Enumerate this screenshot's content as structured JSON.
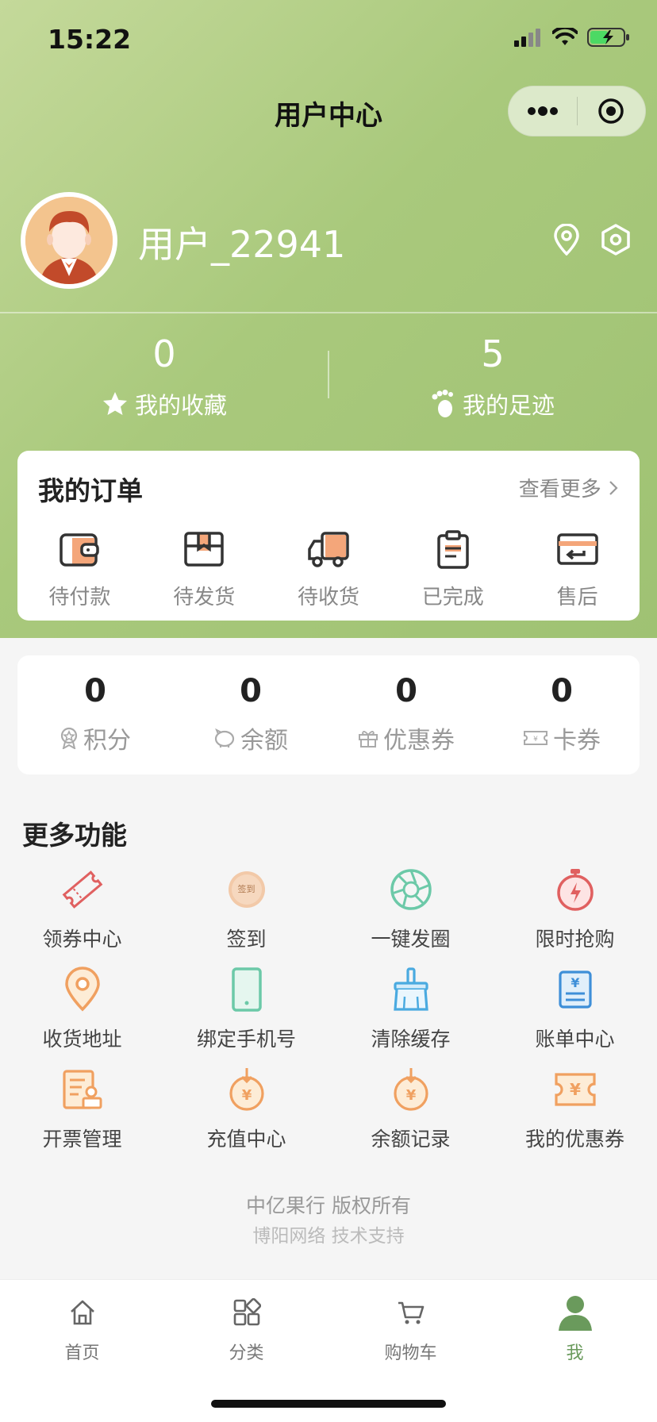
{
  "status_bar": {
    "time": "15:22"
  },
  "nav": {
    "title": "用户中心"
  },
  "profile": {
    "username": "用户_22941"
  },
  "stats": [
    {
      "value": "0",
      "label": "我的收藏",
      "icon": "star-icon"
    },
    {
      "value": "5",
      "label": "我的足迹",
      "icon": "footprint-icon"
    }
  ],
  "orders": {
    "title": "我的订单",
    "more": "查看更多",
    "items": [
      {
        "label": "待付款",
        "icon": "wallet-icon"
      },
      {
        "label": "待发货",
        "icon": "package-icon"
      },
      {
        "label": "待收货",
        "icon": "truck-icon"
      },
      {
        "label": "已完成",
        "icon": "clipboard-icon"
      },
      {
        "label": "售后",
        "icon": "return-card-icon"
      }
    ]
  },
  "assets": [
    {
      "value": "0",
      "label": "积分",
      "icon": "badge-icon"
    },
    {
      "value": "0",
      "label": "余额",
      "icon": "piggy-icon"
    },
    {
      "value": "0",
      "label": "优惠券",
      "icon": "gift-icon"
    },
    {
      "value": "0",
      "label": "卡券",
      "icon": "ticket-icon"
    }
  ],
  "more_functions": {
    "title": "更多功能",
    "items": [
      {
        "label": "领券中心",
        "icon": "coupon-ticket-icon"
      },
      {
        "label": "签到",
        "icon": "checkin-icon",
        "badge": "签到"
      },
      {
        "label": "一键发圈",
        "icon": "aperture-icon"
      },
      {
        "label": "限时抢购",
        "icon": "stopwatch-icon"
      },
      {
        "label": "收货地址",
        "icon": "location-icon"
      },
      {
        "label": "绑定手机号",
        "icon": "phone-icon"
      },
      {
        "label": "清除缓存",
        "icon": "broom-icon"
      },
      {
        "label": "账单中心",
        "icon": "bill-icon"
      },
      {
        "label": "开票管理",
        "icon": "invoice-icon"
      },
      {
        "label": "充值中心",
        "icon": "recharge-icon"
      },
      {
        "label": "余额记录",
        "icon": "balance-record-icon"
      },
      {
        "label": "我的优惠券",
        "icon": "my-coupon-icon"
      }
    ]
  },
  "footer": {
    "copyright": "中亿果行 版权所有",
    "support": "博阳网络 技术支持"
  },
  "tabbar": [
    {
      "label": "首页",
      "icon": "home-icon"
    },
    {
      "label": "分类",
      "icon": "category-icon"
    },
    {
      "label": "购物车",
      "icon": "cart-icon"
    },
    {
      "label": "我",
      "icon": "user-icon",
      "active": true
    }
  ],
  "colors": {
    "accent_green": "#6a9a5c",
    "icon_orange": "#f0a060",
    "icon_red": "#e06060",
    "icon_teal": "#6cc9a8",
    "icon_blue": "#3e8fd8"
  }
}
